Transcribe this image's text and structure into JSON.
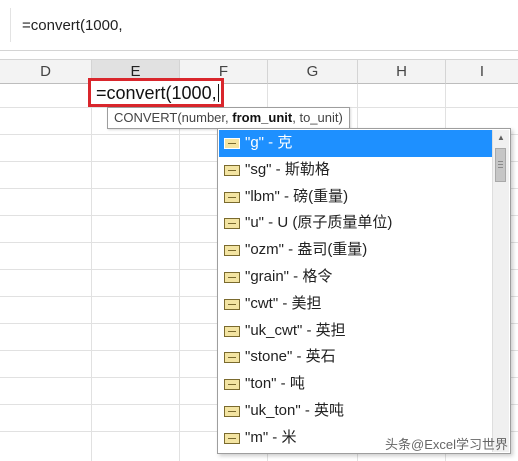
{
  "formula_bar": {
    "value": "=convert(1000,"
  },
  "columns": [
    "D",
    "E",
    "F",
    "G",
    "H",
    "I"
  ],
  "active_cell": {
    "text": "=convert(1000,"
  },
  "tooltip": {
    "func": "CONVERT(",
    "arg1": "number",
    "sep1": ", ",
    "arg2": "from_unit",
    "sep2": ", ",
    "arg3": "to_unit",
    "close": ")"
  },
  "dropdown": {
    "selected_index": 0,
    "items": [
      {
        "label": "\"g\" - 克"
      },
      {
        "label": "\"sg\" - 斯勒格"
      },
      {
        "label": "\"lbm\" - 磅(重量)"
      },
      {
        "label": "\"u\" - U (原子质量单位)"
      },
      {
        "label": "\"ozm\" - 盎司(重量)"
      },
      {
        "label": "\"grain\" - 格令"
      },
      {
        "label": "\"cwt\" - 美担"
      },
      {
        "label": "\"uk_cwt\" - 英担"
      },
      {
        "label": "\"stone\" - 英石"
      },
      {
        "label": "\"ton\" - 吨"
      },
      {
        "label": "\"uk_ton\" - 英吨"
      },
      {
        "label": "\"m\" - 米"
      }
    ]
  },
  "watermark": "头条@Excel学习世界",
  "colors": {
    "highlight": "#1e90ff",
    "cell_border": "#d9262c"
  },
  "icons": {
    "item_icon": "function-icon",
    "scroll_up": "triangle-up-icon"
  }
}
